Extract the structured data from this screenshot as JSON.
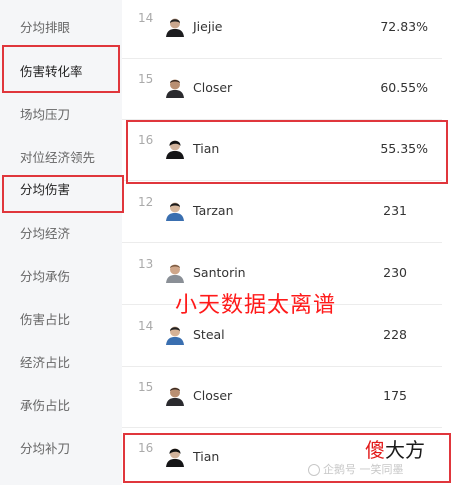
{
  "sidebar": {
    "items": [
      {
        "label": "分均排眼"
      },
      {
        "label": "伤害转化率"
      },
      {
        "label": "场均压刀"
      },
      {
        "label": "对位经济领先"
      },
      {
        "label": "分均伤害"
      },
      {
        "label": "分均经济"
      },
      {
        "label": "分均承伤"
      },
      {
        "label": "伤害占比"
      },
      {
        "label": "经济占比"
      },
      {
        "label": "承伤占比"
      },
      {
        "label": "分均补刀"
      }
    ]
  },
  "rows": [
    {
      "rank": "14",
      "name": "Jiejie",
      "value": "72.83%"
    },
    {
      "rank": "15",
      "name": "Closer",
      "value": "60.55%"
    },
    {
      "rank": "16",
      "name": "Tian",
      "value": "55.35%"
    },
    {
      "rank": "12",
      "name": "Tarzan",
      "value": "231"
    },
    {
      "rank": "13",
      "name": "Santorin",
      "value": "230"
    },
    {
      "rank": "14",
      "name": "Steal",
      "value": "228"
    },
    {
      "rank": "15",
      "name": "Closer",
      "value": "175"
    },
    {
      "rank": "16",
      "name": "Tian",
      "value": ""
    }
  ],
  "overlay": {
    "caption": "小天数据太离谱",
    "logo_part1": "傻",
    "logo_part2": "大方",
    "watermark": "企鹅号 一笑同墨"
  },
  "colors": {
    "highlight": "#e0363c",
    "caption": "#ff1a1a",
    "sidebar_bg": "#f5f6f8"
  }
}
